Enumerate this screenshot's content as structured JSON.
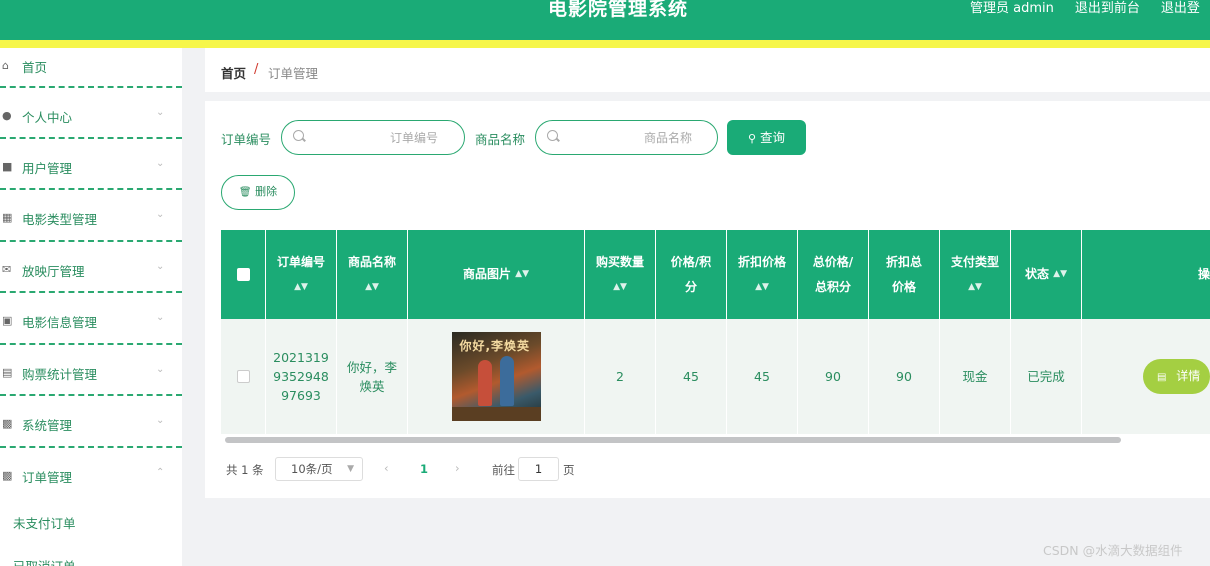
{
  "header": {
    "title": "电影院管理系统",
    "links": [
      "管理员 admin",
      "退出到前台",
      "退出登"
    ]
  },
  "sidebar": {
    "items": [
      {
        "label": "首页",
        "icon": "home-icon"
      },
      {
        "label": "个人中心",
        "icon": "person-icon"
      },
      {
        "label": "用户管理",
        "icon": "users-icon"
      },
      {
        "label": "电影类型管理",
        "icon": "clipboard-icon"
      },
      {
        "label": "放映厅管理",
        "icon": "mail-icon"
      },
      {
        "label": "电影信息管理",
        "icon": "message-icon"
      },
      {
        "label": "购票统计管理",
        "icon": "chart-icon"
      },
      {
        "label": "系统管理",
        "icon": "monitor-icon"
      },
      {
        "label": "订单管理",
        "icon": "monitor-icon"
      }
    ],
    "sub_items": [
      "未支付订单",
      "已取消订单"
    ]
  },
  "breadcrumb": {
    "home": "首页",
    "separator": "/",
    "current": "订单管理"
  },
  "search": {
    "order_no_label": "订单编号",
    "order_no_placeholder": "订单编号",
    "goods_name_label": "商品名称",
    "goods_name_placeholder": "商品名称",
    "query_label": "查询",
    "delete_label": "删除"
  },
  "table": {
    "columns": [
      "订单编号",
      "商品名称",
      "商品图片",
      "购买数量",
      "价格/积分",
      "折扣价格",
      "总价格/总积分",
      "折扣总价格",
      "支付类型",
      "状态",
      "操"
    ],
    "rows": [
      {
        "order_no": [
          "2021319",
          "9352948",
          "97693"
        ],
        "goods_name": [
          "你好，李",
          "焕英"
        ],
        "poster_title": "你好,李焕英",
        "qty": "2",
        "price": "45",
        "discount_price": "45",
        "total": "90",
        "discount_total": "90",
        "pay_type": "现金",
        "status": "已完成",
        "detail_label": "详情"
      }
    ]
  },
  "pager": {
    "total": "共 1 条",
    "page_size": "10条/页",
    "current_page": "1",
    "goto_label": "前往",
    "goto_value": "1",
    "page_suffix": "页"
  },
  "watermark": "CSDN @水滴大数据组件",
  "colors": {
    "primary": "#1aab77",
    "accent_yellow": "#f6f64a",
    "detail_button": "#a4cf42"
  }
}
